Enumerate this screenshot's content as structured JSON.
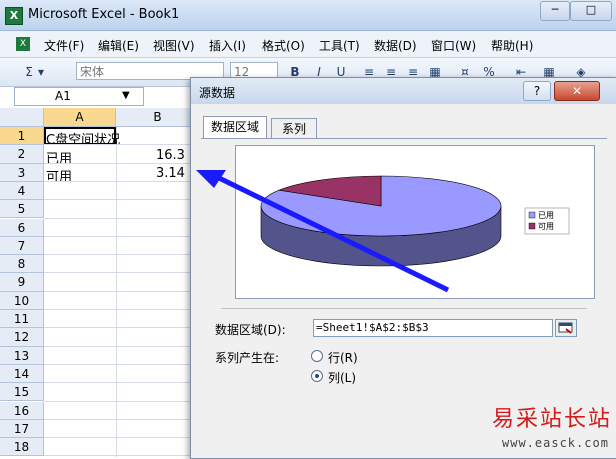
{
  "window": {
    "title": "Microsoft Excel - Book1",
    "app_icon": "X",
    "min_label": "─",
    "max_label": "□"
  },
  "menu": {
    "items": [
      "文件(F)",
      "编辑(E)",
      "视图(V)",
      "插入(I)",
      "格式(O)",
      "工具(T)",
      "数据(D)",
      "窗口(W)",
      "帮助(H)"
    ]
  },
  "toolbar": {
    "sigma": "Σ",
    "font_name": "宋体",
    "font_size": "12",
    "bold": "B",
    "italic": "I",
    "underline": "U",
    "percent": "%"
  },
  "formula": {
    "name_box": "A1"
  },
  "sheet": {
    "columns": [
      "A",
      "B"
    ],
    "rows": [
      "1",
      "2",
      "3",
      "4",
      "5",
      "6",
      "7",
      "8",
      "9",
      "10",
      "11",
      "12",
      "13",
      "14",
      "15",
      "16",
      "17",
      "18"
    ],
    "cells": {
      "A1": "C盘空间状况",
      "A2": "已用",
      "B2": "16.3",
      "A3": "可用",
      "B3": "3.14"
    }
  },
  "dialog": {
    "title": "源数据",
    "help": "?",
    "close": "✕",
    "tabs": [
      "数据区域",
      "系列"
    ],
    "range_label": "数据区域(D):",
    "range_value": "=Sheet1!$A$2:$B$3",
    "series_in_label": "系列产生在:",
    "radio_row": "行(R)",
    "radio_col": "列(L)",
    "selected": "列(L)"
  },
  "chart_data": {
    "type": "pie",
    "categories": [
      "已用",
      "可用"
    ],
    "values": [
      16.3,
      3.14
    ],
    "colors": [
      "#9999ff",
      "#993366"
    ],
    "legend_position": "right",
    "three_d": true
  },
  "watermark": {
    "text": "易采站长站",
    "url": "www.easck.com"
  },
  "colors": {
    "arrow": "#1a1aff",
    "pie_used": "#9999ff",
    "pie_free": "#993366"
  }
}
